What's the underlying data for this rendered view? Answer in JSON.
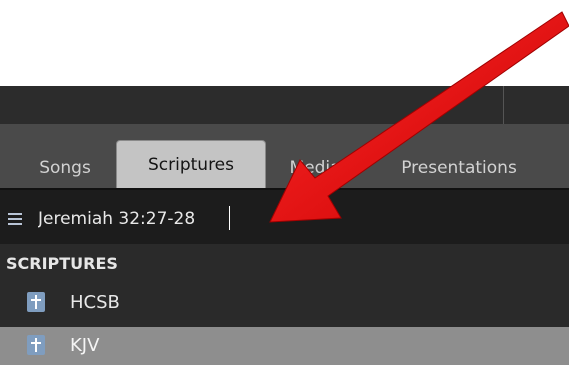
{
  "tabs": [
    {
      "label": "Songs"
    },
    {
      "label": "Scriptures",
      "active": true
    },
    {
      "label": "Media"
    },
    {
      "label": "Presentations"
    }
  ],
  "search": {
    "value": "Jeremiah 32:27-28"
  },
  "section": {
    "header": "SCRIPTURES"
  },
  "items": [
    {
      "label": "HCSB",
      "icon": "bible-icon"
    },
    {
      "label": "KJV",
      "icon": "bible-icon",
      "selected": true
    }
  ],
  "colors": {
    "arrow": "#e01010",
    "active_tab": "#c4c4c4",
    "selected_row": "#8e8e8e"
  }
}
